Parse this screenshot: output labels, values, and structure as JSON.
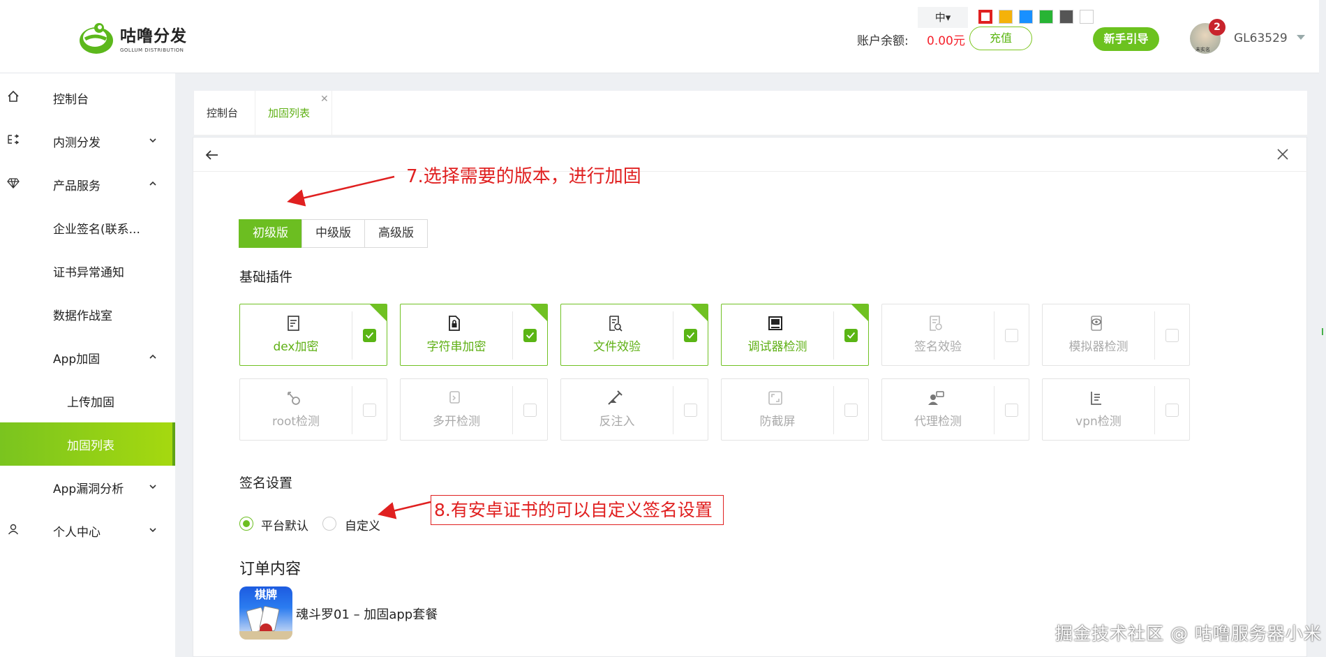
{
  "app": {
    "logo_cn": "咕噜分发",
    "logo_en": "GOLLUM DISTRIBUTION"
  },
  "header": {
    "font_size": "中▾",
    "theme_colors": [
      "#e02020",
      "#f5b20a",
      "#1890ff",
      "#28b435",
      "#555555",
      "#ffffff"
    ],
    "balance_label": "账户余额:",
    "balance_value": "0.00元",
    "recharge": "充值",
    "guide": "新手引导",
    "notifications": "2",
    "avatar_label": "未实名",
    "username": "GL63529"
  },
  "sidebar": {
    "items": [
      {
        "label": "控制台",
        "icon": "home-icon"
      },
      {
        "label": "内测分发",
        "icon": "distribute-icon",
        "expand": "down"
      },
      {
        "label": "产品服务",
        "icon": "diamond-icon",
        "expand": "up"
      },
      {
        "label": "企业签名(联系..."
      },
      {
        "label": "证书异常通知"
      },
      {
        "label": "数据作战室"
      },
      {
        "label": "App加固",
        "expand": "up"
      },
      {
        "label": "上传加固"
      },
      {
        "label": "加固列表",
        "active": true
      },
      {
        "label": "App漏洞分析",
        "expand": "down"
      },
      {
        "label": "个人中心",
        "icon": "user-icon",
        "expand": "down"
      }
    ]
  },
  "tabs": [
    {
      "label": "控制台"
    },
    {
      "label": "加固列表",
      "active": true
    }
  ],
  "annotations": {
    "step7": "7.选择需要的版本，进行加固",
    "step8": "8.有安卓证书的可以自定义签名设置"
  },
  "versions": [
    "初级版",
    "中级版",
    "高级版"
  ],
  "active_version": "初级版",
  "plugins_title": "基础插件",
  "plugins": [
    {
      "label": "dex加密",
      "checked": true,
      "icon": "dex-icon"
    },
    {
      "label": "字符串加密",
      "checked": true,
      "icon": "string-lock-icon"
    },
    {
      "label": "文件效验",
      "checked": true,
      "icon": "file-check-icon"
    },
    {
      "label": "调试器检测",
      "checked": true,
      "icon": "debugger-icon"
    },
    {
      "label": "签名效验",
      "checked": false,
      "icon": "signature-icon"
    },
    {
      "label": "模拟器检测",
      "checked": false,
      "icon": "emulator-icon"
    },
    {
      "label": "root检测",
      "checked": false,
      "icon": "root-icon"
    },
    {
      "label": "多开检测",
      "checked": false,
      "icon": "multi-open-icon"
    },
    {
      "label": "反注入",
      "checked": false,
      "icon": "anti-inject-icon"
    },
    {
      "label": "防截屏",
      "checked": false,
      "icon": "screenshot-icon"
    },
    {
      "label": "代理检测",
      "checked": false,
      "icon": "proxy-icon"
    },
    {
      "label": "vpn检测",
      "checked": false,
      "icon": "vpn-icon"
    }
  ],
  "signature": {
    "title": "签名设置",
    "options": [
      "平台默认",
      "自定义"
    ],
    "selected": "平台默认"
  },
  "order": {
    "title": "订单内容",
    "app_tag": "棋牌",
    "app_name": "魂斗罗01 – 加固app套餐"
  },
  "watermark": "掘金技术社区 @ 咕噜服务器小米"
}
